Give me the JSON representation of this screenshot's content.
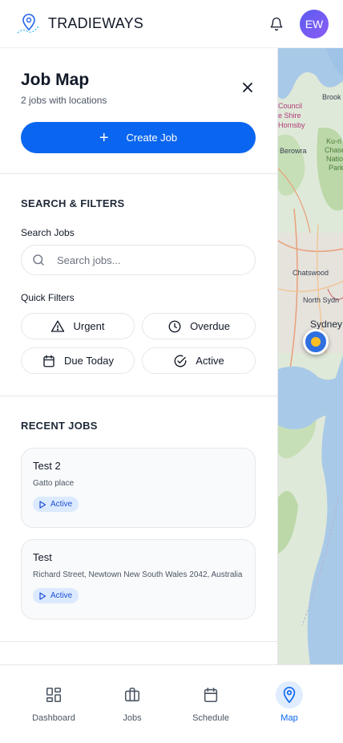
{
  "header": {
    "brand": "TRADIEWAYS",
    "avatar_initials": "EW",
    "logo_icon": "map-pin-route-icon",
    "notification_icon": "bell-icon"
  },
  "panel": {
    "title": "Job Map",
    "subtitle": "2 jobs with locations",
    "create_label": "Create Job",
    "filters_title": "SEARCH & FILTERS",
    "search_label": "Search Jobs",
    "search_placeholder": "Search jobs...",
    "quick_filters_label": "Quick Filters",
    "chips": [
      {
        "label": "Urgent",
        "icon": "warning-triangle-icon"
      },
      {
        "label": "Overdue",
        "icon": "clock-icon"
      },
      {
        "label": "Due Today",
        "icon": "calendar-icon"
      },
      {
        "label": "Active",
        "icon": "check-circle-icon"
      }
    ],
    "recent_title": "RECENT JOBS",
    "jobs": [
      {
        "title": "Test 2",
        "address": "Gatto place",
        "status": "Active"
      },
      {
        "title": "Test",
        "address": "Richard Street, Newtown New South Wales 2042, Australia",
        "status": "Active"
      }
    ]
  },
  "map": {
    "labels": [
      "Brook",
      "Council",
      "e Shire",
      "Hornsby",
      "Berowra",
      "Ku-ri",
      "Chase",
      "Natio",
      "Park",
      "Chatswood",
      "North Sydn",
      "Sydney"
    ],
    "water_color": "#a9c9e8",
    "land_color": "#dfe9d9",
    "pin_color": "#2f6fe0"
  },
  "nav": {
    "items": [
      {
        "label": "Dashboard",
        "icon": "dashboard-icon"
      },
      {
        "label": "Jobs",
        "icon": "briefcase-icon"
      },
      {
        "label": "Schedule",
        "icon": "calendar-icon"
      },
      {
        "label": "Map",
        "icon": "map-pin-icon"
      }
    ],
    "active": "Map"
  },
  "colors": {
    "primary": "#0a66f0",
    "badge_bg": "#dbeafe",
    "badge_text": "#1d4ed8"
  }
}
